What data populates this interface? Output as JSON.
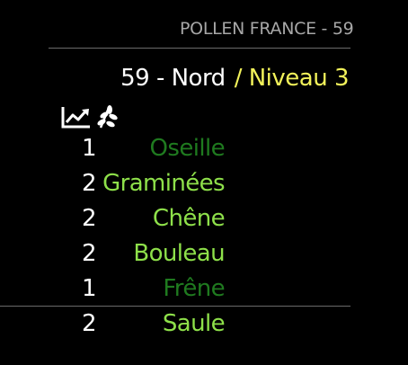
{
  "module": {
    "header": "POLLEN FRANCE - 59",
    "location": "59 - Nord",
    "level": "/ Niveau 3",
    "icons": [
      "trend-chart-icon",
      "leaf-sprig-icon"
    ],
    "colors": {
      "header": "#a7a7a7",
      "level": "#f2f25a",
      "risk_1": "#1f7a1f",
      "risk_2": "#8ee04a"
    }
  },
  "pollens": [
    {
      "value": "1",
      "name": "Oseille"
    },
    {
      "value": "2",
      "name": "Graminées"
    },
    {
      "value": "2",
      "name": "Chêne"
    },
    {
      "value": "2",
      "name": "Bouleau"
    },
    {
      "value": "1",
      "name": "Frêne"
    },
    {
      "value": "2",
      "name": "Saule"
    }
  ]
}
